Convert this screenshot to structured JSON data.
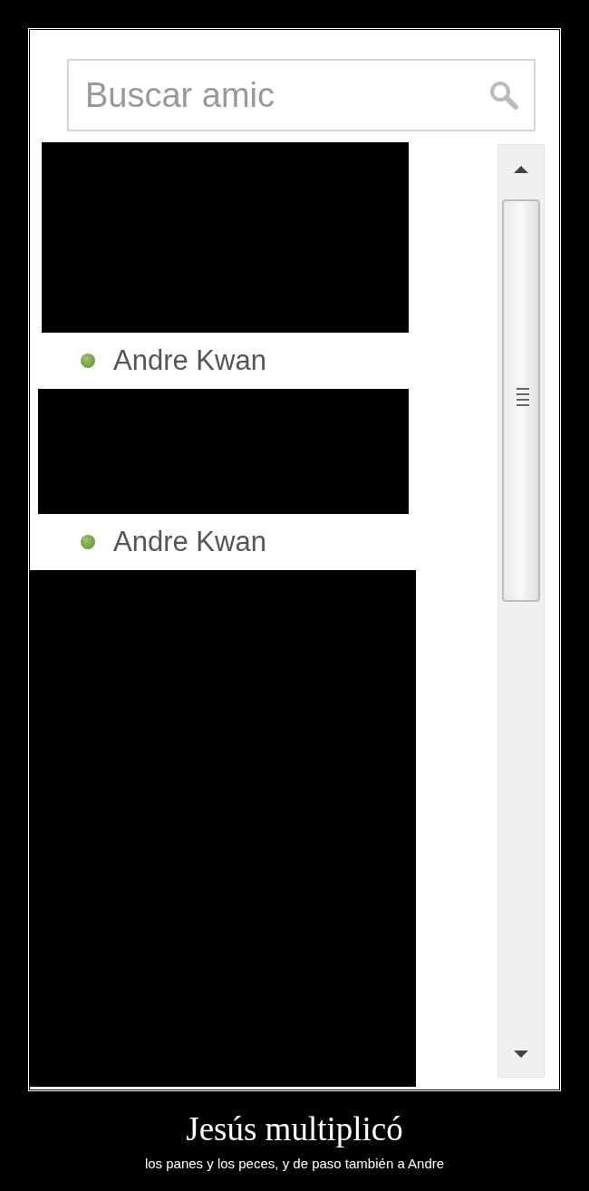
{
  "search": {
    "placeholder": "Buscar amic"
  },
  "contacts": [
    {
      "name": "Andre Kwan",
      "online": true
    },
    {
      "name": "Andre Kwan",
      "online": true
    }
  ],
  "caption": {
    "title": "Jesús multiplicó",
    "subtitle": "los panes y los peces, y de paso también a Andre"
  }
}
